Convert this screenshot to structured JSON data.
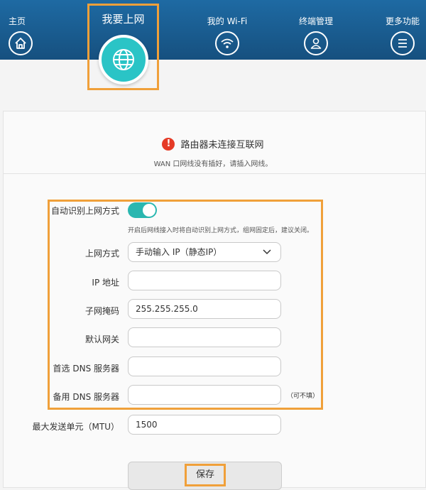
{
  "nav": {
    "home": "主页",
    "internet": "我要上网",
    "wifi": "我的 Wi-Fi",
    "devices": "终端管理",
    "more": "更多功能"
  },
  "status": {
    "title": "路由器未连接互联网",
    "subtitle": "WAN 口网线没有插好，请插入网线。",
    "icon": "!"
  },
  "form": {
    "auto_detect_label": "自动识别上网方式",
    "auto_detect_on": true,
    "auto_detect_hint": "开启后网线接入时将自动识别上网方式，组网固定后，建议关闭。",
    "mode_label": "上网方式",
    "mode_value": "手动输入 IP（静态IP）",
    "ip_label": "IP 地址",
    "ip_value": "",
    "mask_label": "子网掩码",
    "mask_value": "255.255.255.0",
    "gateway_label": "默认网关",
    "gateway_value": "",
    "dns1_label": "首选 DNS 服务器",
    "dns1_value": "",
    "dns2_label": "备用 DNS 服务器",
    "dns2_value": "",
    "dns2_note": "（可不填）",
    "mtu_label": "最大发送单元（MTU）",
    "mtu_value": "1500",
    "save_label": "保存"
  },
  "colors": {
    "header": "#1a5f95",
    "accent": "#2ac4c6",
    "highlight": "#f0a03a",
    "alert": "#e53a26"
  }
}
